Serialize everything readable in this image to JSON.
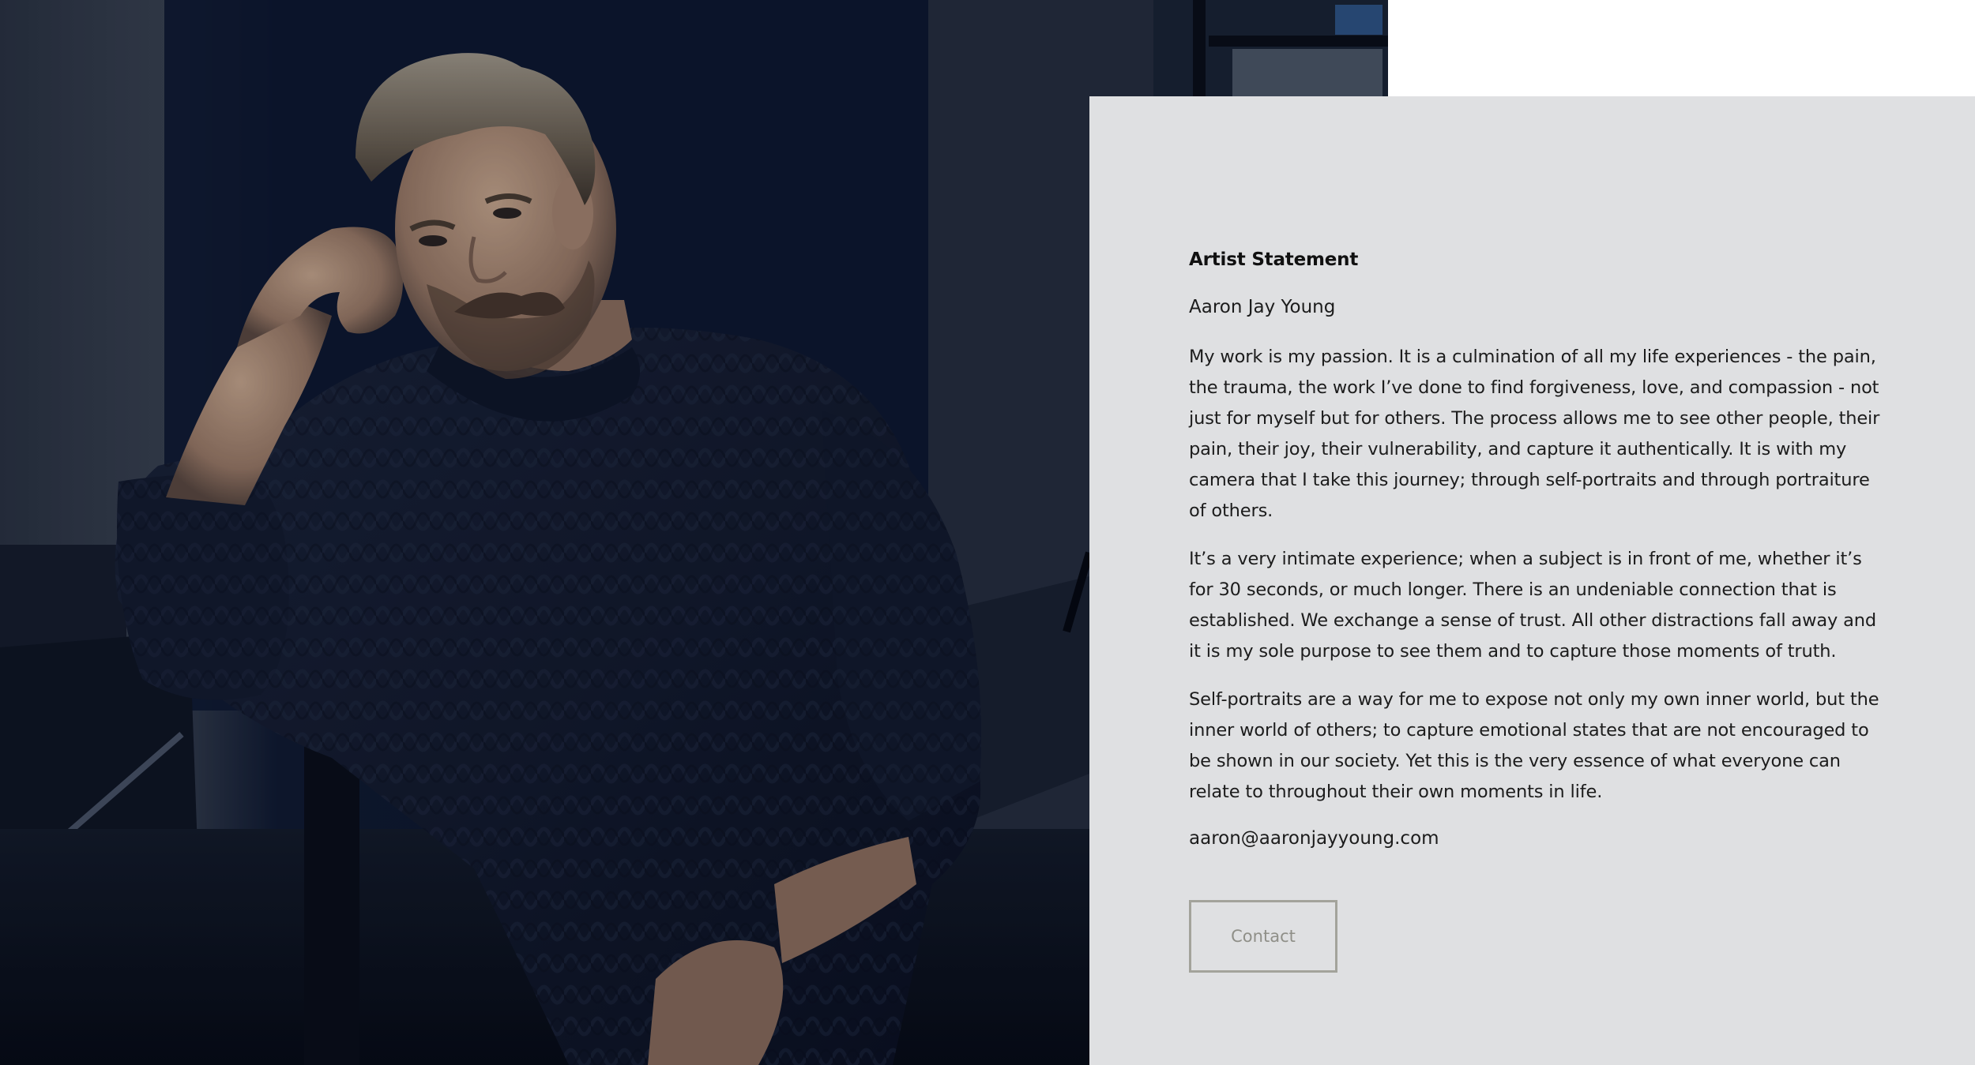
{
  "statement": {
    "heading": "Artist Statement",
    "artist_name": "Aaron Jay Young",
    "paragraphs": [
      "My work is my passion. It is a culmination of all my life experiences - the pain, the trauma, the work I’ve done to find forgiveness, love, and compassion - not just for myself but for others. The process allows me to see other people, their pain, their joy, their vulnerability, and capture it authentically. It is with my camera that I take this journey; through self-portraits and through portraiture of others.",
      "It’s a very intimate experience; when a subject is in front of me, whether it’s for 30 seconds, or much longer. There is an undeniable connection that is established. We exchange a sense of trust. All other distractions fall away and it is my sole purpose to see them and to capture those moments of truth.",
      "Self-portraits are a way for me to expose not only my own inner world, but the inner world of others; to capture emotional states that are not encouraged to be shown in our society. Yet this is the very essence of what everyone can relate to throughout their own moments in life."
    ],
    "email": "aaron@aaronjayyoung.com",
    "contact_label": "Contact"
  },
  "colors": {
    "panel_background": "#dfe0e2",
    "text": "#1c1c1c",
    "button_border": "#a3a39b",
    "button_text": "#8f8f88",
    "photo_tone": "#0d1526"
  },
  "photo": {
    "subject": "portrait of a bearded man in a dark navy cable-knit sweater, chin resting on hand"
  }
}
